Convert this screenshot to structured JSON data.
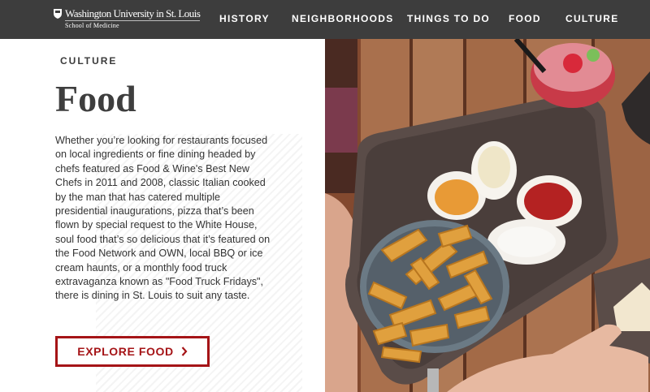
{
  "header": {
    "logo": {
      "line1": "Washington University in St. Louis",
      "line2": "School of Medicine"
    },
    "nav": [
      {
        "label": "HISTORY"
      },
      {
        "label": "NEIGHBORHOODS"
      },
      {
        "label": "THINGS TO DO"
      },
      {
        "label": "FOOD"
      },
      {
        "label": "CULTURE"
      }
    ]
  },
  "main": {
    "eyebrow": "CULTURE",
    "title": "Food",
    "body": "Whether you’re looking for restaurants focused on local ingredients or fine dining headed by chefs featured as Food & Wine's Best New Chefs in 2011 and 2008, classic Italian cooked by the man that has catered multiple presidential inaugurations, pizza that’s been flown by special request to the White House, soul food that’s so delicious that it’s featured on the Food Network and OWN, local BBQ or ice cream haunts, or a monthly food truck extravaganza known as \"Food Truck Fridays\", there is dining in St. Louis to suit any taste.",
    "cta": {
      "label": "EXPLORE FOOD",
      "icon": "chevron-right-icon"
    }
  },
  "colors": {
    "header_bg": "#3d3d3d",
    "accent": "#a51417",
    "text": "#333333"
  }
}
